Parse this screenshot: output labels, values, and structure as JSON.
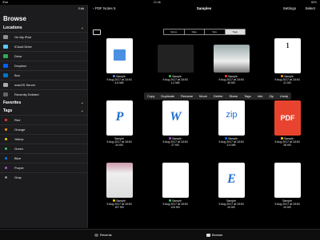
{
  "status": {
    "carrier": "iPad",
    "time": "21:46",
    "battery": "80%"
  },
  "sidebar": {
    "edit_label": "Edit",
    "title": "Browse",
    "locations_label": "Locations",
    "locations": [
      {
        "label": "On My iPad",
        "color": "#8e8e93"
      },
      {
        "label": "iCloud Drive",
        "color": "#5ac8fa"
      },
      {
        "label": "Drive",
        "color": "#34a853"
      },
      {
        "label": "Dropbox",
        "color": "#0061fe"
      },
      {
        "label": "Box",
        "color": "#0075c9"
      },
      {
        "label": "macOS Server",
        "color": "#aaaaaa"
      },
      {
        "label": "Recently Deleted",
        "color": "#636366"
      }
    ],
    "favorites_label": "Favorites",
    "tags_label": "Tags",
    "tags": [
      {
        "label": "Red",
        "color": "#ff3b30"
      },
      {
        "label": "Orange",
        "color": "#ff9500"
      },
      {
        "label": "Yellow",
        "color": "#ffcc00"
      },
      {
        "label": "Green",
        "color": "#34c759"
      },
      {
        "label": "Blue",
        "color": "#007aff"
      },
      {
        "label": "Purple",
        "color": "#af52de"
      },
      {
        "label": "Gray",
        "color": "#8e8e93"
      }
    ]
  },
  "navbar": {
    "back_label": "PDF Notes 5",
    "title": "Samples",
    "settings_label": "Settings",
    "select_label": "Select"
  },
  "sort": {
    "options": [
      "Name",
      "Date",
      "Size",
      "Tags"
    ],
    "active": "Tags"
  },
  "context_menu": [
    "Copy",
    "Duplicate",
    "Rename",
    "Move",
    "Delete",
    "Share",
    "Tags",
    "Info",
    "Zip",
    "Unzip"
  ],
  "files": [
    {
      "name": "Sample",
      "date": "9 Aug 2017 at 18:54",
      "size": "4.6 MB",
      "dot": "#5b8def",
      "icon": "audio-file-icon",
      "glyph": ""
    },
    {
      "name": "Sample",
      "date": "9 Aug 2017 at 18:54",
      "size": "1.2 MB",
      "dot": "#34c759",
      "icon": "video-thumbnail-icon",
      "glyph": ""
    },
    {
      "name": "Sample",
      "date": "9 Aug 2017 at 18:54",
      "size": "49 KB",
      "dot": "#ff3b30",
      "icon": "image-thumbnail-icon",
      "glyph": ""
    },
    {
      "name": "Sample",
      "date": "9 Aug 2017 at 18:54",
      "size": "21 KB",
      "dot": "#ff9500",
      "icon": "pdf-page-icon",
      "glyph": "1"
    },
    {
      "name": "Sample",
      "date": "9 Aug 2017 at 18:54",
      "size": "24 KB",
      "dot": "",
      "icon": "pages-file-icon",
      "glyph": "P"
    },
    {
      "name": "Sample",
      "date": "9 Aug 2017 at 18:54",
      "size": "27 KB",
      "dot": "#af52de",
      "icon": "word-file-icon",
      "glyph": "W"
    },
    {
      "name": "Sample",
      "date": "9 Aug 2017 at 18:54",
      "size": "2.4 MB",
      "dot": "#007aff",
      "icon": "zip-file-icon",
      "glyph": "zip"
    },
    {
      "name": "Sample",
      "date": "9 Aug 2017 at 18:54",
      "size": "28 KB",
      "dot": "#ffcc00",
      "icon": "pdf-file-icon",
      "glyph": "PDF"
    },
    {
      "name": "Sample",
      "date": "9 Aug 2017 at 18:54",
      "size": "107 KB",
      "dot": "#ffcc00",
      "icon": "magazine-thumbnail-icon",
      "glyph": ""
    },
    {
      "name": "Sample",
      "date": "9 Aug 2017 at 18:54",
      "size": "124 KB",
      "dot": "#34c759",
      "icon": "report-thumbnail-icon",
      "glyph": ""
    },
    {
      "name": "Sample",
      "date": "9 Aug 2017 at 18:54",
      "size": "24 KB",
      "dot": "",
      "icon": "excel-file-icon",
      "glyph": "E"
    },
    {
      "name": "Sample",
      "date": "9 Aug 2017 at 18:54",
      "size": "24 KB",
      "dot": "",
      "icon": "text-file-icon",
      "glyph": ""
    }
  ],
  "tabbar": {
    "recents_label": "Recents",
    "browse_label": "Browse"
  }
}
